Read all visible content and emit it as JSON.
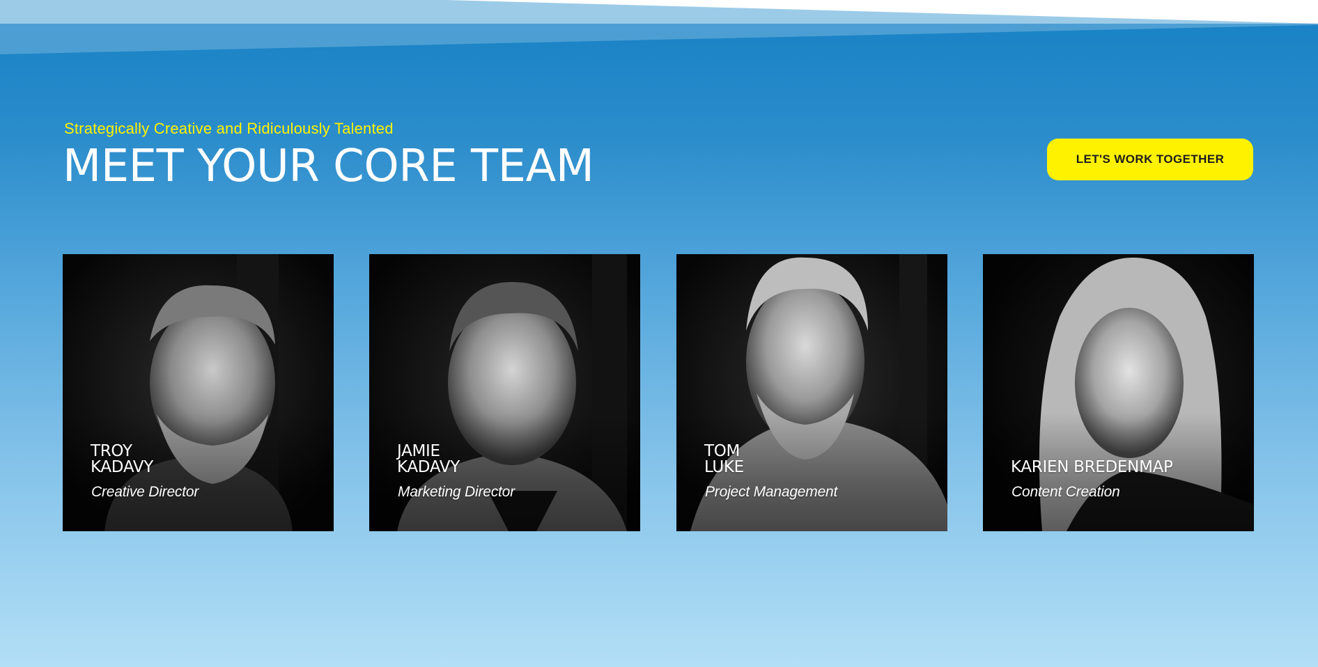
{
  "hero": {
    "eyebrow": "Strategically Creative and Ridiculously Talented",
    "title": "MEET YOUR CORE TEAM",
    "cta_label": "LET'S WORK TOGETHER"
  },
  "team": [
    {
      "name_line1": "TROY",
      "name_line2": "KADAVY",
      "role": "Creative Director"
    },
    {
      "name_line1": "JAMIE",
      "name_line2": "KADAVY",
      "role": "Marketing Director"
    },
    {
      "name_line1": "TOM",
      "name_line2": "LUKE",
      "role": "Project Management"
    },
    {
      "name_line1": "KARIEN BREDENMAP",
      "name_line2": "",
      "role": "Content Creation"
    }
  ],
  "colors": {
    "accent_yellow": "#fff200",
    "background_top": "#1681c4",
    "background_bottom": "#b3dff6",
    "heading_text": "#ffffff",
    "button_text": "#1d1d1d"
  }
}
